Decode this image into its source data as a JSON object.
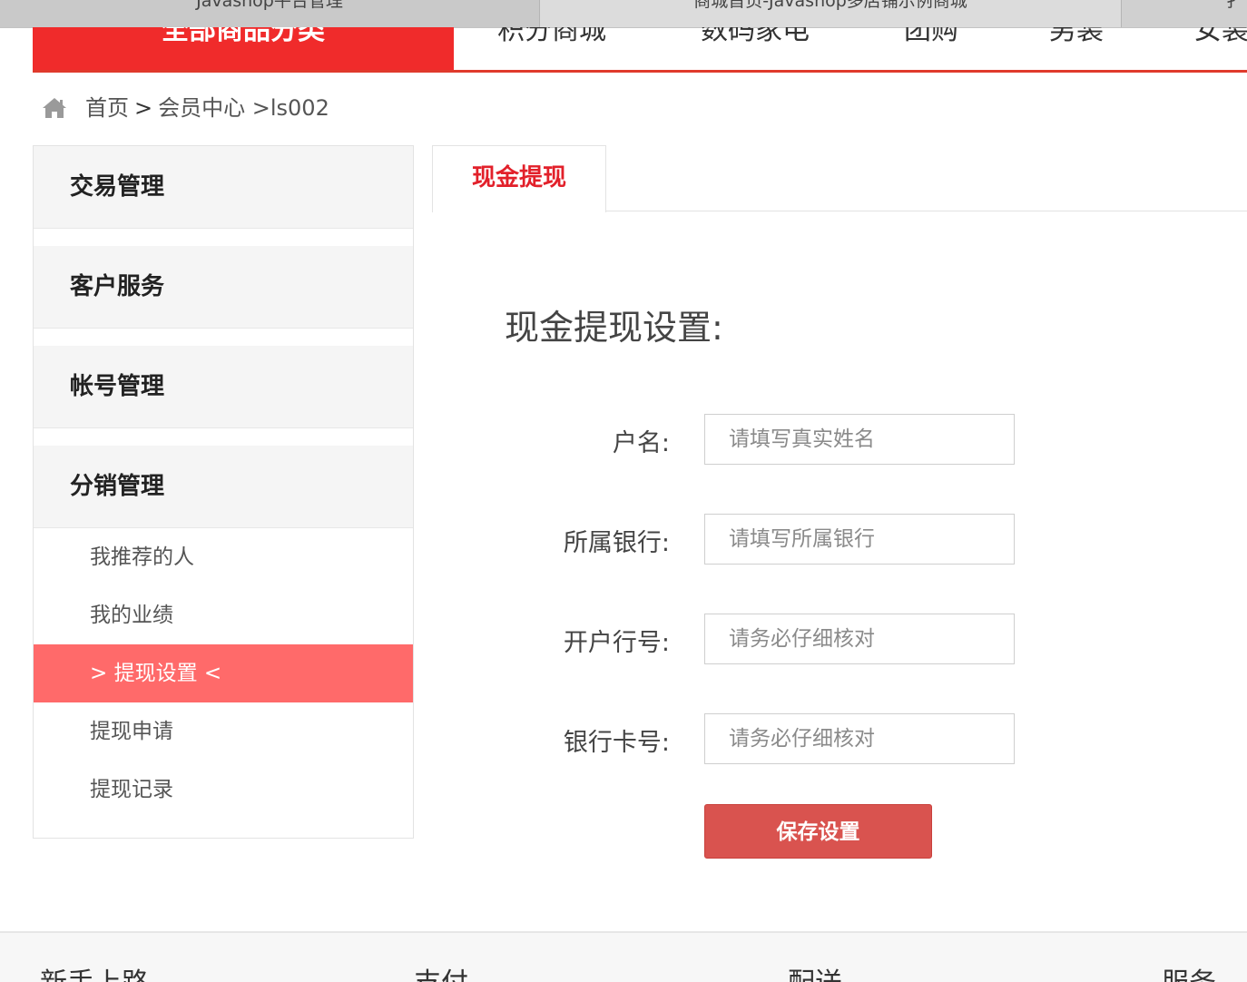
{
  "browser_tabs": [
    "Javashop平台管理",
    "商城首页-Javashop多店铺示例商城",
    "扌"
  ],
  "nav": {
    "all_categories": "全部商品分类",
    "items": [
      "积分商城",
      "数码家电",
      "团购",
      "男装",
      "女装"
    ]
  },
  "breadcrumb": {
    "home": "首页",
    "sep": ">",
    "member": "会员中心",
    "user": ">ls002"
  },
  "sidebar": {
    "groups": [
      "交易管理",
      "客户服务",
      "帐号管理",
      "分销管理"
    ],
    "items": [
      "我推荐的人",
      "我的业绩",
      "> 提现设置 <",
      "提现申请",
      "提现记录"
    ],
    "active_index": 2
  },
  "content": {
    "tab_label": "现金提现",
    "form_title": "现金提现设置:",
    "fields": [
      {
        "label": "户名:",
        "placeholder": "请填写真实姓名",
        "value": ""
      },
      {
        "label": "所属银行:",
        "placeholder": "请填写所属银行",
        "value": ""
      },
      {
        "label": "开户行号:",
        "placeholder": "请务必仔细核对",
        "value": ""
      },
      {
        "label": "银行卡号:",
        "placeholder": "请务必仔细核对",
        "value": ""
      }
    ],
    "save_label": "保存设置"
  },
  "footer": {
    "columns": [
      "新手上路",
      "支付",
      "配送",
      "服务"
    ]
  },
  "colors": {
    "accent_red": "#f02b2b",
    "active_item": "#ff6a6a",
    "save_button": "#d9534f",
    "tab_text": "#e2202a"
  },
  "icons": {
    "home": "home-icon"
  }
}
